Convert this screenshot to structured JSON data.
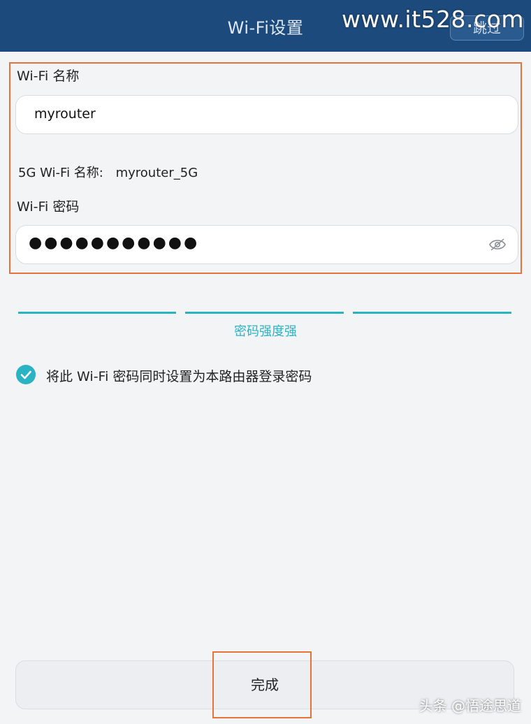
{
  "header": {
    "title": "Wi-Fi设置",
    "skip_label": "跳过",
    "watermark": "www.it528.com"
  },
  "form": {
    "ssid_label": "Wi-Fi 名称",
    "ssid_value": "myrouter",
    "ssid_5g_label": "5G Wi-Fi 名称:",
    "ssid_5g_value": "myrouter_5G",
    "password_label": "Wi-Fi 密码",
    "password_masked": "●●●●●●●●●●●",
    "password_visibility_icon": "eye-icon"
  },
  "strength": {
    "label": "密码强度强",
    "level": 3,
    "max": 3,
    "color": "#2ab3c2"
  },
  "sync_option": {
    "label": "将此 Wi-Fi 密码同时设置为本路由器登录密码",
    "checked": true
  },
  "footer": {
    "done_label": "完成",
    "watermark": "头条 @悟途思道"
  },
  "colors": {
    "header_bg": "#1c4a7c",
    "accent": "#2ab3c2",
    "highlight": "#e8733a"
  }
}
